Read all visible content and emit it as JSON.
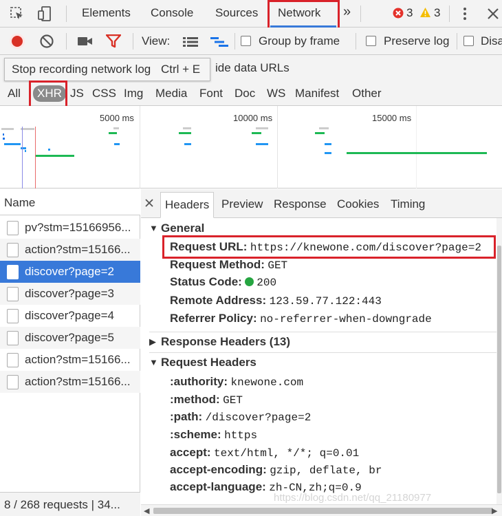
{
  "top_tabs": {
    "elements": "Elements",
    "console": "Console",
    "sources": "Sources",
    "network": "Network",
    "more": "»",
    "errors_count": "3",
    "warnings_count": "3"
  },
  "toolbar": {
    "view_label": "View:",
    "group_by_frame": "Group by frame",
    "preserve_log": "Preserve log",
    "disable_cache": "Disa"
  },
  "filter": {
    "tooltip_text": "Stop recording network log",
    "tooltip_shortcut": "Ctrl + E",
    "hide_data_urls": "ide data URLs"
  },
  "type_filters": [
    "All",
    "XHR",
    "JS",
    "CSS",
    "Img",
    "Media",
    "Font",
    "Doc",
    "WS",
    "Manifest",
    "Other"
  ],
  "overview": {
    "ticks": [
      "5000 ms",
      "10000 ms",
      "15000 ms"
    ]
  },
  "requests": {
    "header": "Name",
    "rows": [
      "pv?stm=15166956...",
      "action?stm=15166...",
      "discover?page=2",
      "discover?page=3",
      "discover?page=4",
      "discover?page=5",
      "action?stm=15166...",
      "action?stm=15166..."
    ],
    "selected_index": 2,
    "status": "8 / 268 requests  |  34..."
  },
  "details": {
    "tabs": [
      "Headers",
      "Preview",
      "Response",
      "Cookies",
      "Timing"
    ],
    "active_tab": "Headers",
    "general": {
      "title": "General",
      "request_url_key": "Request URL:",
      "request_url_val": "https://knewone.com/discover?page=2",
      "request_method_key": "Request Method:",
      "request_method_val": "GET",
      "status_code_key": "Status Code:",
      "status_code_val": "200",
      "remote_address_key": "Remote Address:",
      "remote_address_val": "123.59.77.122:443",
      "referrer_policy_key": "Referrer Policy:",
      "referrer_policy_val": "no-referrer-when-downgrade"
    },
    "response_headers_title": "Response Headers (13)",
    "request_headers": {
      "title": "Request Headers",
      "items": [
        {
          "k": ":authority:",
          "v": "knewone.com"
        },
        {
          "k": ":method:",
          "v": "GET"
        },
        {
          "k": ":path:",
          "v": "/discover?page=2"
        },
        {
          "k": ":scheme:",
          "v": "https"
        },
        {
          "k": "accept:",
          "v": "text/html, */*; q=0.01"
        },
        {
          "k": "accept-encoding:",
          "v": "gzip, deflate, br"
        },
        {
          "k": "accept-language:",
          "v": "zh-CN,zh;q=0.9"
        }
      ]
    },
    "watermark": "https://blog.csdn.net/qq_21180977"
  },
  "colors": {
    "highlight_red": "#d9222a",
    "selected_row": "#3879d9",
    "record_red": "#d93025",
    "status_green": "#26a541",
    "bar_blue": "#2196f3",
    "bar_green": "#1db954"
  }
}
